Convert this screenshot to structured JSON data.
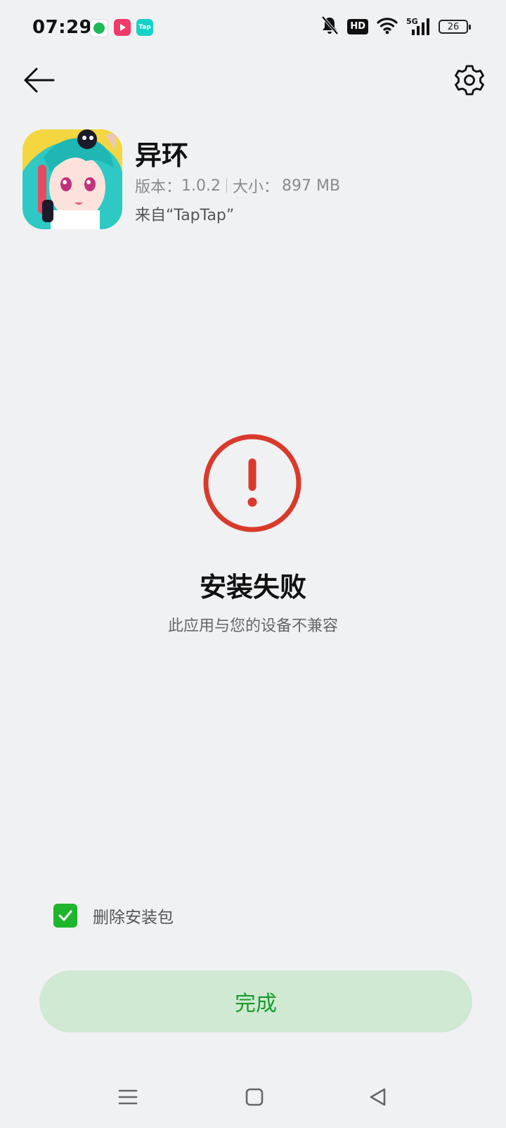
{
  "status_bar": {
    "time": "07:29",
    "hd_label": "HD",
    "network_label": "5G",
    "battery_level": "26",
    "notification_icons": [
      "spotify-icon",
      "video-play-icon",
      "taptap-icon"
    ],
    "tap_badge_text": "Tap"
  },
  "app": {
    "name": "异环",
    "version_label": "版本：",
    "version": "1.0.2",
    "size_label": "大小：",
    "size": "897 MB",
    "source": "来自“TapTap”"
  },
  "result": {
    "title": "安装失败",
    "message": "此应用与您的设备不兼容",
    "status_color": "#d93a2b"
  },
  "options": {
    "delete_package_label": "删除安装包",
    "delete_package_checked": true
  },
  "actions": {
    "done_label": "完成"
  },
  "colors": {
    "accent": "#1fb52c",
    "button_bg": "#cfe9d3",
    "button_text": "#199a2a",
    "error": "#d93a2b"
  }
}
